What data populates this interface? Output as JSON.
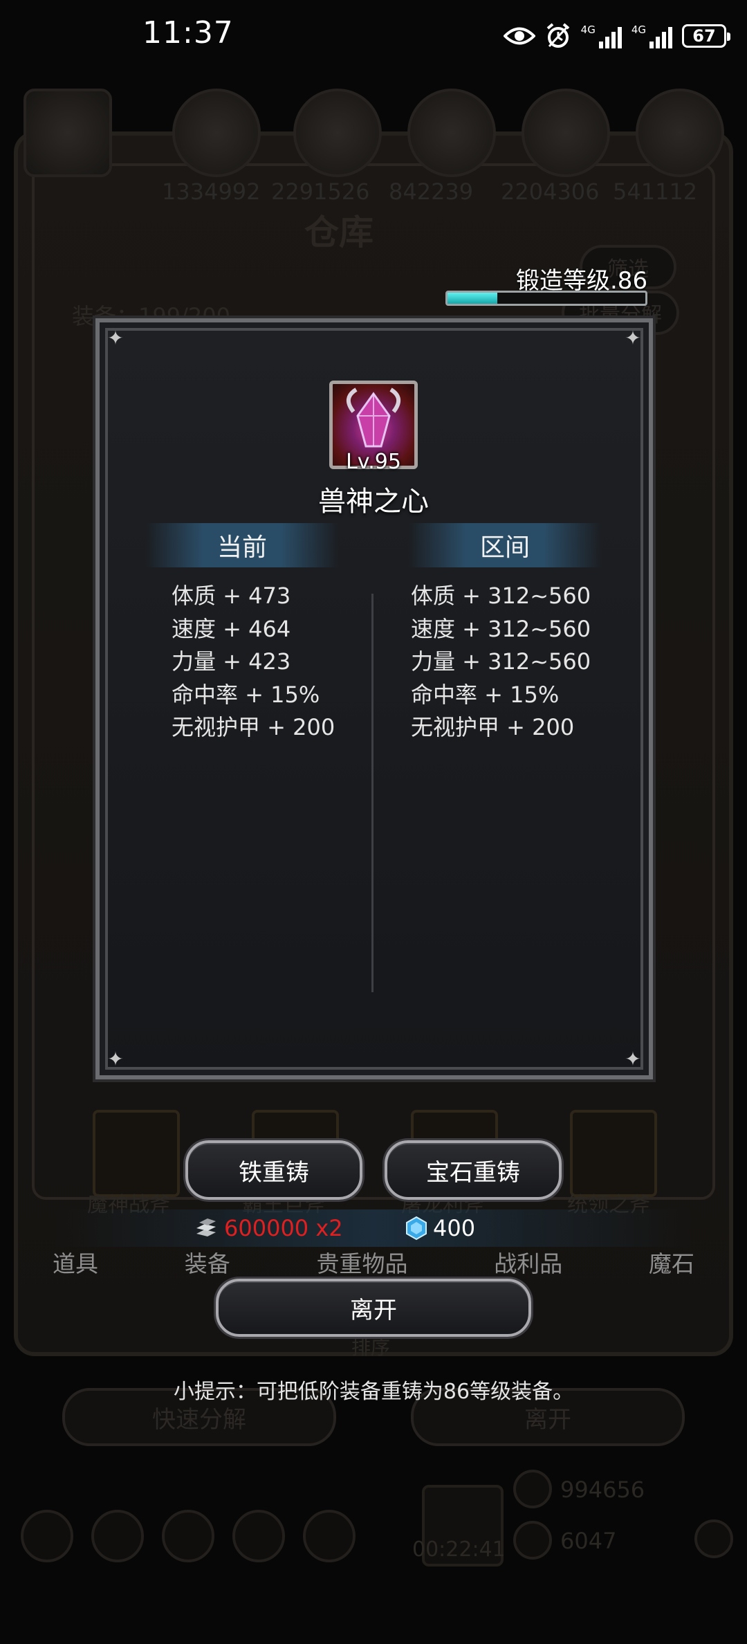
{
  "status_bar": {
    "time": "11:37",
    "network_1": "4G",
    "network_2": "4G",
    "battery": "67",
    "icons": [
      "eye-icon",
      "alarm-icon",
      "signal-icon",
      "signal-icon",
      "battery-icon"
    ]
  },
  "background": {
    "resource_counts": [
      "1334992",
      "2291526",
      "842239",
      "2204306",
      "541112"
    ],
    "window_title": "仓库",
    "filter_label": "筛选",
    "equip_count_label": "装备：199/200",
    "batch_decompose": "批量分解",
    "item_names": [
      "魔神战斧",
      "霸王巨斧",
      "屠龙利斧",
      "统领之斧"
    ],
    "sort_label": "排序",
    "quick_decompose": "快速分解",
    "leave": "离开",
    "gold": "994656",
    "gems": "6047",
    "timer": "00:22:41"
  },
  "forge": {
    "label": "锻造等级.86",
    "progress": 0.25
  },
  "item": {
    "icon": "beast-heart-gem-icon",
    "level": "Lv.95",
    "name": "兽神之心"
  },
  "current": {
    "header": "当前",
    "stats": [
      "体质 + 473",
      "速度 + 464",
      "力量 + 423",
      "命中率 + 15%",
      "无视护甲 + 200"
    ]
  },
  "range": {
    "header": "区间",
    "stats": [
      "体质 + 312~560",
      "速度 + 312~560",
      "力量 + 312~560",
      "命中率 + 15%",
      "无视护甲 + 200"
    ]
  },
  "actions": {
    "iron_recast": "铁重铸",
    "gem_recast": "宝石重铸",
    "iron_cost": "600000 x2",
    "gem_cost": "400",
    "leave": "离开"
  },
  "tabs": [
    "道具",
    "装备",
    "贵重物品",
    "战利品",
    "魔石"
  ],
  "hint": "小提示：可把低阶装备重铸为86等级装备。",
  "colors": {
    "cost_red": "#e02020",
    "accent_cyan": "#2fc7c9",
    "header_blue": "#2d5573"
  }
}
